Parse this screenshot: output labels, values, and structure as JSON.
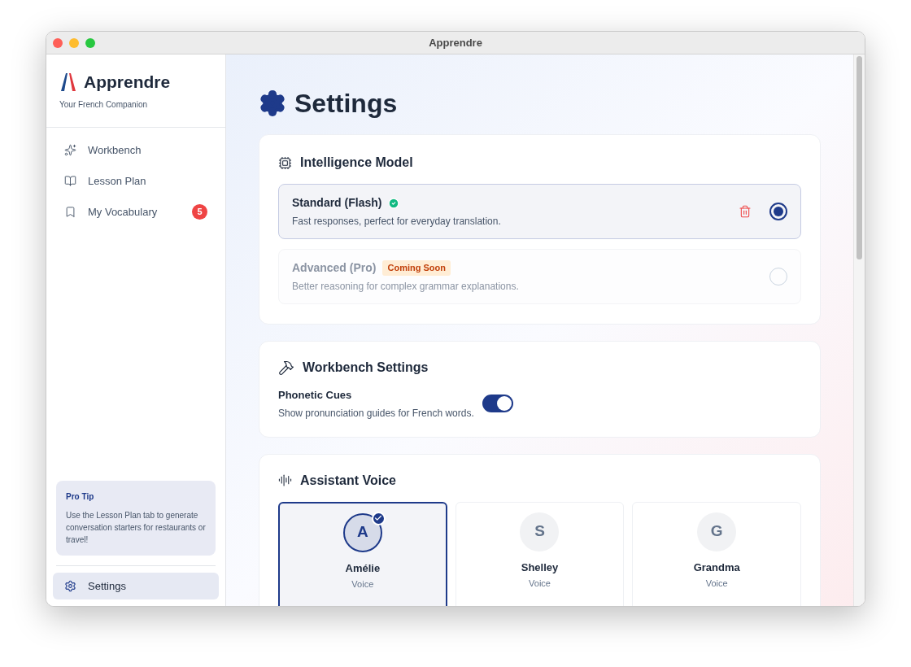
{
  "window": {
    "title": "Apprendre"
  },
  "sidebar": {
    "brand": "Apprendre",
    "tagline": "Your French Companion",
    "items": [
      {
        "label": "Workbench",
        "kind": "sparkles",
        "selected": false
      },
      {
        "label": "Lesson Plan",
        "kind": "book",
        "selected": false
      },
      {
        "label": "My Vocabulary",
        "kind": "bookmark",
        "selected": false,
        "badge": "5"
      }
    ],
    "tip": {
      "title": "Pro Tip",
      "text": "Use the Lesson Plan tab to generate conversation starters for restaurants or travel!"
    },
    "footer": {
      "label": "Settings",
      "selected": true
    }
  },
  "page": {
    "title": "Settings"
  },
  "model_section": {
    "title": "Intelligence Model",
    "models": [
      {
        "name": "Standard (Flash)",
        "description": "Fast responses, perfect for everyday translation.",
        "selected": true,
        "disabled": false,
        "verified": true
      },
      {
        "name": "Advanced (Pro)",
        "description": "Better reasoning for complex grammar explanations.",
        "selected": false,
        "disabled": true,
        "verified": false,
        "badge": "Coming Soon"
      }
    ]
  },
  "workbench_section": {
    "title": "Workbench Settings",
    "toggle": {
      "label": "Phonetic Cues",
      "description": "Show pronunciation guides for French words.",
      "on": true
    }
  },
  "voice_section": {
    "title": "Assistant Voice",
    "voices": [
      {
        "initial": "A",
        "name": "Amélie",
        "subtitle": "Voice",
        "selected": true
      },
      {
        "initial": "S",
        "name": "Shelley",
        "subtitle": "Voice",
        "selected": false
      },
      {
        "initial": "G",
        "name": "Grandma",
        "subtitle": "Voice",
        "selected": false
      }
    ]
  }
}
